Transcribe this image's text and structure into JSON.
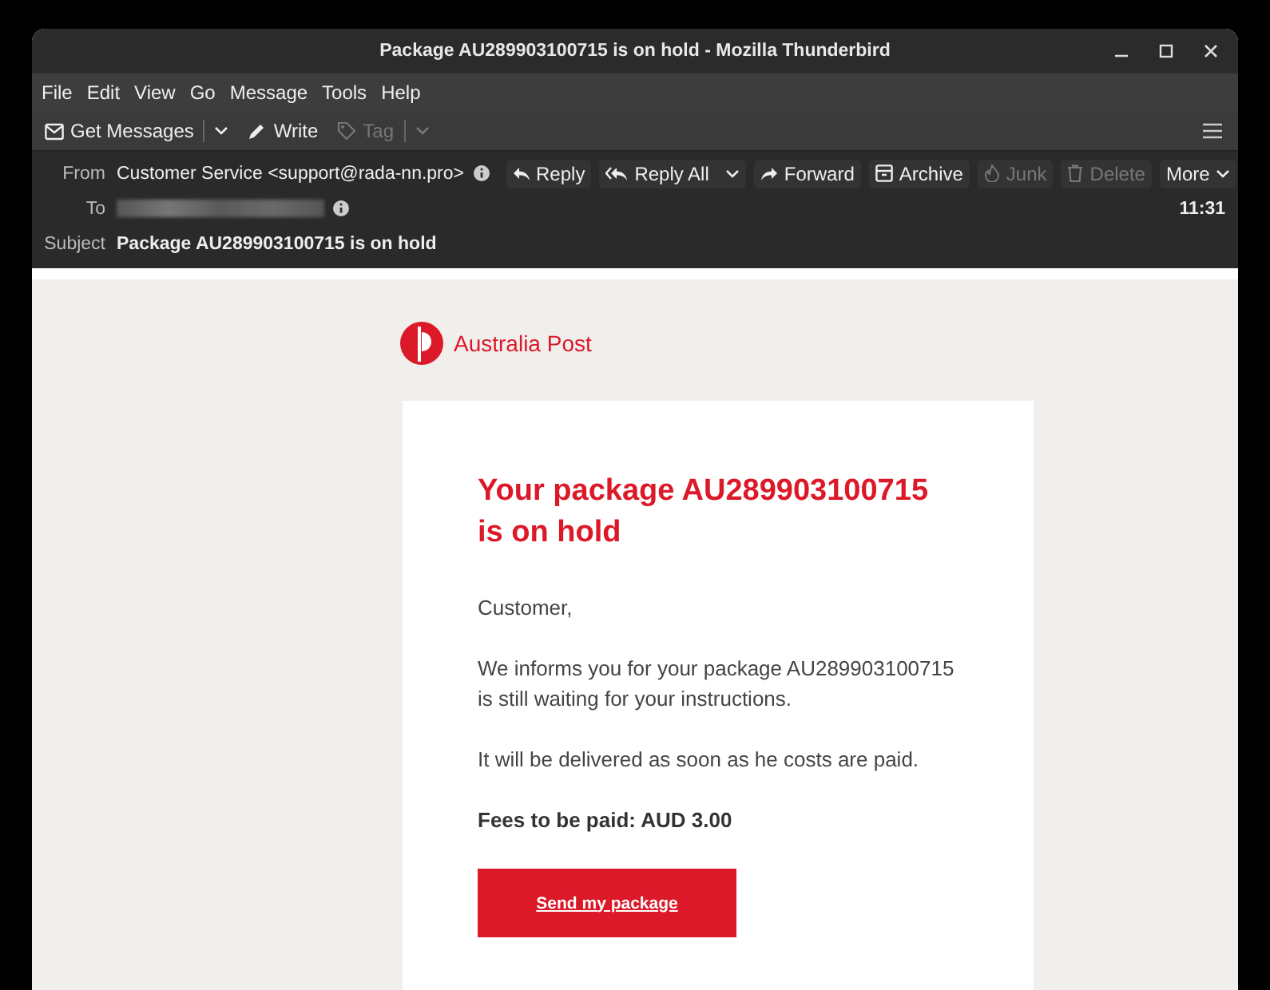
{
  "window": {
    "title": "Package AU289903100715 is on hold - Mozilla Thunderbird"
  },
  "menu": [
    "File",
    "Edit",
    "View",
    "Go",
    "Message",
    "Tools",
    "Help"
  ],
  "toolbar": [
    {
      "kind": "get",
      "label": "Get Messages",
      "disabled": false
    },
    {
      "kind": "write",
      "label": "Write",
      "disabled": false
    },
    {
      "kind": "tag",
      "label": "Tag",
      "disabled": true
    }
  ],
  "header": {
    "from_label": "From",
    "from": "Customer Service <support@rada-nn.pro>",
    "to_label": "To",
    "time": "11:31",
    "subject_label": "Subject",
    "subject": "Package AU289903100715 is on hold",
    "actions": [
      {
        "kind": "reply",
        "label": "Reply",
        "disabled": false
      },
      {
        "kind": "replyall",
        "label": "Reply All",
        "disabled": false
      },
      {
        "kind": "forward",
        "label": "Forward",
        "disabled": false
      },
      {
        "kind": "archive",
        "label": "Archive",
        "disabled": false
      },
      {
        "kind": "junk",
        "label": "Junk",
        "disabled": true
      },
      {
        "kind": "delete",
        "label": "Delete",
        "disabled": true
      },
      {
        "kind": "more",
        "label": "More",
        "disabled": false
      }
    ]
  },
  "email": {
    "brand": "Australia Post",
    "heading": "Your package AU289903100715 is on hold",
    "paragraphs": [
      {
        "kind": "text",
        "text": "Customer,"
      },
      {
        "kind": "text",
        "text": "We informs you for your package AU289903100715 is still waiting for your instructions."
      },
      {
        "kind": "text",
        "text": "It will be delivered as soon as he costs are paid."
      },
      {
        "kind": "strong",
        "text": "Fees to be paid: AUD 3.00"
      }
    ],
    "button": "Send my package"
  }
}
